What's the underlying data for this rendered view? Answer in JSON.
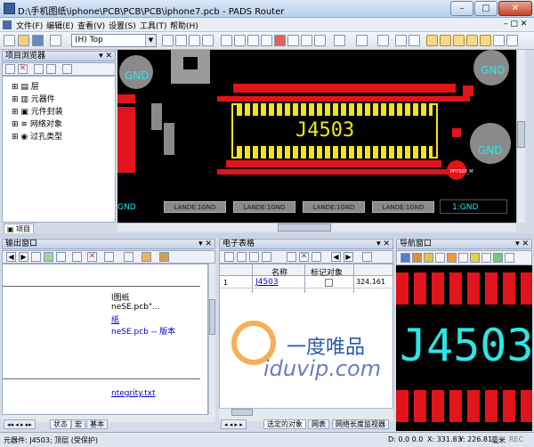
{
  "window": {
    "title": "D:\\手机图纸\\iphone\\PCB\\PCB\\PCB\\iphone7.pcb - PADS Router",
    "minimize": "–",
    "maximize": "□",
    "close": "✕"
  },
  "menu": [
    "文件(F)",
    "编辑(E)",
    "查看(V)",
    "设置(S)",
    "工具(T)",
    "帮助(H)"
  ],
  "toolbar": {
    "layer_value": "(H) Top"
  },
  "project_browser": {
    "title": "项目浏览器",
    "tree": [
      "层",
      "元器件",
      "元件封装",
      "网络对象",
      "过孔类型"
    ],
    "tab": "项目"
  },
  "pcb": {
    "component_label": "J4503",
    "gnd_labels": [
      "GND",
      "GND",
      "GND"
    ],
    "lande_labels": [
      "LANDE:1GND",
      "LANDE:1GND",
      "LANDE:1GND",
      "LANDE:1GND"
    ],
    "lower_gnd_left": "GND",
    "lower_gnd_right": "1:GND",
    "small_label": "PP7500_M"
  },
  "output_window": {
    "title": "输出窗口",
    "lines": [
      "l图纸",
      "neSE.pcb\"...",
      "纸",
      "neSE.pcb -- 版本",
      "ntegrity.txt"
    ],
    "tabs": [
      "状态",
      "宏",
      "基本"
    ]
  },
  "spreadsheet": {
    "title": "电子表格",
    "columns": [
      "名称",
      "标记对象"
    ],
    "rows": [
      {
        "index": "1",
        "name": "J4503",
        "value": "324.161"
      }
    ],
    "tabs": [
      "选定的对象",
      "网表",
      "网络长度监视器"
    ]
  },
  "nav_window": {
    "title": "导航窗口",
    "label": "J4503"
  },
  "watermark": {
    "text_cn": "一度唯品",
    "text_url": "iduvip.com"
  },
  "status": {
    "left": "元器件: J4503; 顶层 (受保护)",
    "d": "D: 0.0 0.0",
    "x": "X: 331.83",
    "y": "Y: 226.81",
    "unit": "毫米",
    "rec": "REC"
  },
  "colors": {
    "pad_red": "#e1141b",
    "gold_finger": "#f1e516",
    "label_cyan": "#2ce6e6",
    "board_bg": "#000000"
  }
}
